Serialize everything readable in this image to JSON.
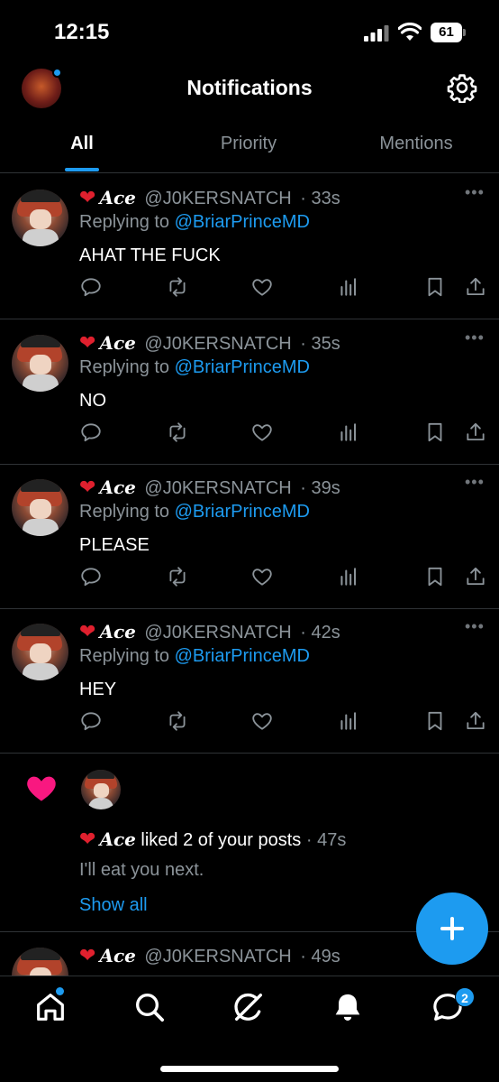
{
  "status_bar": {
    "time": "12:15",
    "battery": "61"
  },
  "header": {
    "title": "Notifications"
  },
  "tabs": [
    {
      "label": "All",
      "active": true
    },
    {
      "label": "Priority",
      "active": false
    },
    {
      "label": "Mentions",
      "active": false
    }
  ],
  "posts": [
    {
      "name": "Ace",
      "handle": "@J0KERSNATCH",
      "time": "· 33s",
      "replying_prefix": "Replying to",
      "replying_to": "@BriarPrinceMD",
      "text": "AHAT THE FUCK"
    },
    {
      "name": "Ace",
      "handle": "@J0KERSNATCH",
      "time": "· 35s",
      "replying_prefix": "Replying to",
      "replying_to": "@BriarPrinceMD",
      "text": "NO"
    },
    {
      "name": "Ace",
      "handle": "@J0KERSNATCH",
      "time": "· 39s",
      "replying_prefix": "Replying to",
      "replying_to": "@BriarPrinceMD",
      "text": "PLEASE"
    },
    {
      "name": "Ace",
      "handle": "@J0KERSNATCH",
      "time": "· 42s",
      "replying_prefix": "Replying to",
      "replying_to": "@BriarPrinceMD",
      "text": "HEY"
    }
  ],
  "like_notification": {
    "name": "Ace",
    "action": "liked 2 of your posts",
    "time": "· 47s",
    "quote": "I'll eat you next.",
    "show_all": "Show all"
  },
  "partial_post": {
    "name": "Ace",
    "handle": "@J0KERSNATCH",
    "time": "· 49s"
  },
  "bottom_nav": {
    "messages_badge": "2"
  },
  "colors": {
    "accent": "#1d9bf0",
    "background": "#000000",
    "muted": "#8b9399",
    "like_pink": "#f91880"
  },
  "icons": [
    "reply-icon",
    "repost-icon",
    "like-icon",
    "views-icon",
    "bookmark-icon",
    "share-icon",
    "gear-icon",
    "home-icon",
    "search-icon",
    "grok-icon",
    "bell-icon",
    "messages-icon"
  ]
}
